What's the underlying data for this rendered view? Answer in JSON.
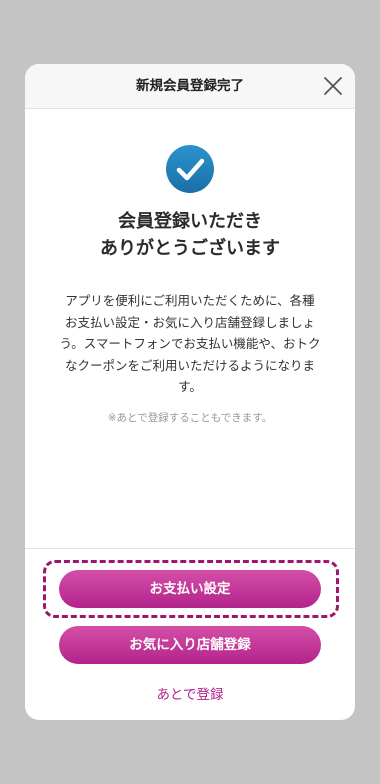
{
  "header": {
    "title": "新規会員登録完了",
    "close_icon": "close-icon"
  },
  "status": {
    "icon": "check-circle-icon",
    "icon_color": "#1f7fb9",
    "headline_line1": "会員登録いただき",
    "headline_line2": "ありがとうございます"
  },
  "message": {
    "body_lines": [
      "アプリを便利にご利用いただくために、各種",
      "お支払い設定・お気に入り店舗登録しましょ",
      "う。スマートフォンでお支払い機能や、おトク",
      "なクーポンをご利用いただけるようになりま",
      "す。"
    ],
    "note": "※あとで登録することもできます。"
  },
  "actions": {
    "payment_button": "お支払い設定",
    "favorite_store_button": "お気に入り店舗登録",
    "later_link": "あとで登録"
  },
  "colors": {
    "accent": "#b3238b",
    "accent_light": "#d44fa8",
    "highlight": "#a0166e",
    "backdrop": "#c4c4c4"
  }
}
